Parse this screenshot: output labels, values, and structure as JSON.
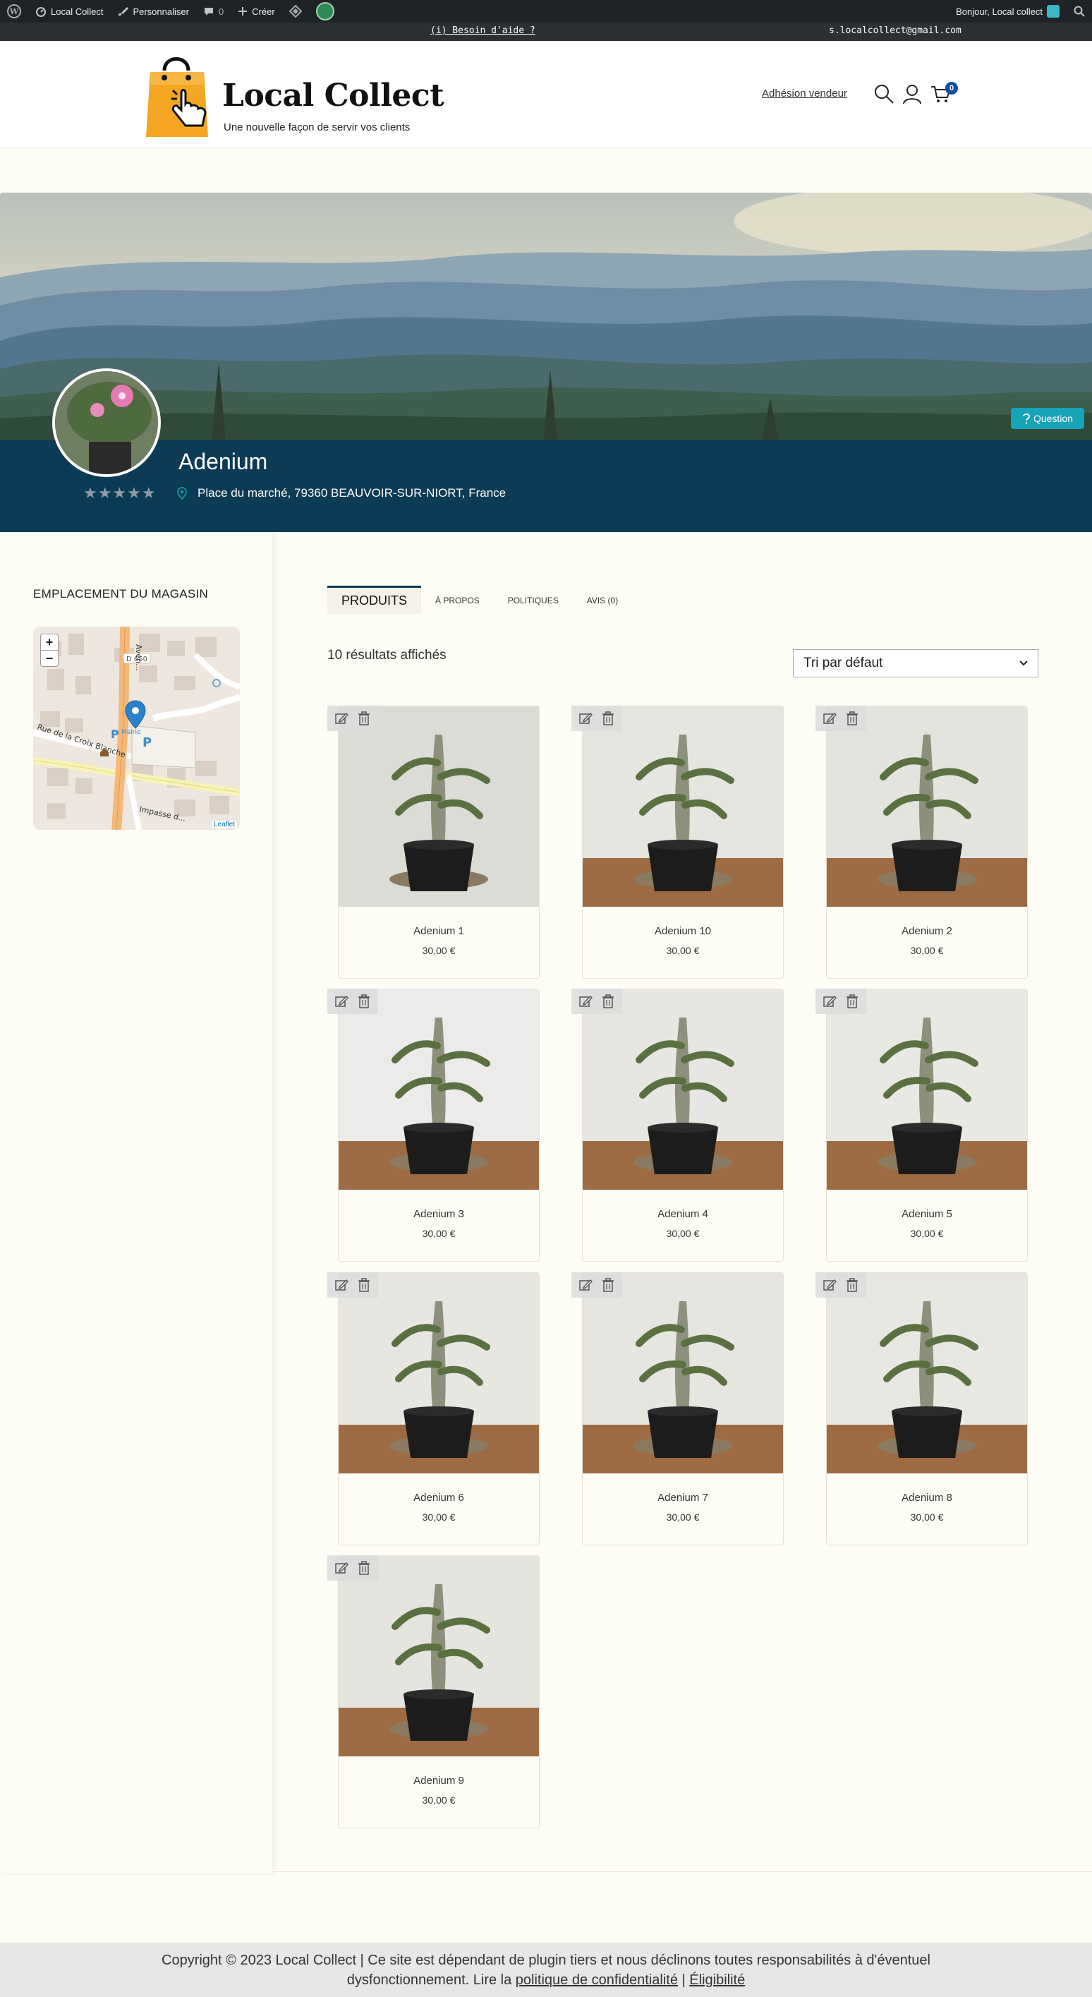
{
  "admin_bar": {
    "site_name": "Local Collect",
    "customize": "Personnaliser",
    "comments": "0",
    "create": "Créer",
    "greeting": "Bonjour, Local collect"
  },
  "notice": {
    "help": "(i) Besoin d'aide ?",
    "email": "s.localcollect@gmail.com"
  },
  "header": {
    "logo_title": "Local Collect",
    "tagline": "Une nouvelle façon de servir vos clients",
    "vendor_link": "Adhésion vendeur",
    "cart_count": "0"
  },
  "store": {
    "name": "Adenium",
    "address": "Place du marché, 79360 BEAUVOIR-SUR-NIORT, France",
    "question_label": "Question",
    "rating_stars": 0
  },
  "sidebar": {
    "widget_title": "EMPLACEMENT DU MAGASIN",
    "map": {
      "zoom_in": "+",
      "zoom_out": "−",
      "road_label": "D 650",
      "street_1": "Rue de la Croix Blanche",
      "street_2": "Impasse d...",
      "street_3": "Aven...",
      "marker_label": "Mairie",
      "attribution": "Leaflet"
    }
  },
  "tabs": [
    "PRODUITS",
    "À PROPOS",
    "POLITIQUES",
    "AVIS (0)"
  ],
  "results_text": "10 résultats affichés",
  "sort_selected": "Tri par défaut",
  "products": [
    {
      "name": "Adenium 1",
      "price": "30,00 €"
    },
    {
      "name": "Adenium 10",
      "price": "30,00 €"
    },
    {
      "name": "Adenium 2",
      "price": "30,00 €"
    },
    {
      "name": "Adenium 3",
      "price": "30,00 €"
    },
    {
      "name": "Adenium 4",
      "price": "30,00 €"
    },
    {
      "name": "Adenium 5",
      "price": "30,00 €"
    },
    {
      "name": "Adenium 6",
      "price": "30,00 €"
    },
    {
      "name": "Adenium 7",
      "price": "30,00 €"
    },
    {
      "name": "Adenium 8",
      "price": "30,00 €"
    },
    {
      "name": "Adenium 9",
      "price": "30,00 €"
    }
  ],
  "footer": {
    "line1": "Copyright © 2023 Local Collect | Ce site est dépendant de plugin tiers et nous déclinons toutes responsabilités à d'éventuel",
    "line2_prefix": "dysfonctionnement. Lire la",
    "privacy_link": "politique de confidentialité",
    "separator": "|",
    "eligibility_link": "Éligibilité"
  },
  "colors": {
    "store_band": "#0c3b55",
    "accent": "#17a3b8",
    "cart_badge": "#0d4ea0",
    "logo_bag": "#f4a623"
  }
}
